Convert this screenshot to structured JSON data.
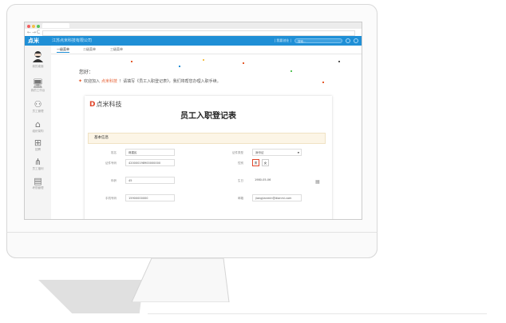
{
  "app": {
    "logo": "点米",
    "company": "江苏点米科技有限公司",
    "header_links": [
      "| 我要创业 |"
    ],
    "search_placeholder": "搜索..."
  },
  "sidebar": {
    "user_label": "我的桌面",
    "items": [
      {
        "icon": "desktop-icon",
        "glyph": "🖥",
        "label": "我的工作台"
      },
      {
        "icon": "staff-icon",
        "glyph": "⚇",
        "label": "员工管理"
      },
      {
        "icon": "org-icon",
        "glyph": "⌂",
        "label": "组织架构"
      },
      {
        "icon": "bag-icon",
        "glyph": "⊞",
        "label": "招聘"
      },
      {
        "icon": "clothes-icon",
        "glyph": "⋔",
        "label": "员工福利"
      },
      {
        "icon": "calendar-icon",
        "glyph": "▤",
        "label": "考勤管理"
      }
    ]
  },
  "tabs": [
    "一级菜单",
    "二级菜单",
    "三级菜单"
  ],
  "greeting": "您好：",
  "welcome": {
    "prefix": "欢迎加入",
    "company": "点米科技",
    "suffix": "！请填写《员工入职登记表》，我们将帮您办理入职手续。"
  },
  "form": {
    "logo_mark": "D",
    "logo_text": "点米科技",
    "title": "员工入职登记表",
    "section": "基本信息",
    "fields": [
      {
        "label": "姓名",
        "value": "蒋建民"
      },
      {
        "label": "证件类型",
        "value": "身份证"
      },
      {
        "label": "证件号码",
        "value": "420000198900000000"
      },
      {
        "label": "性别",
        "value": ""
      },
      {
        "label": "年龄",
        "value": "45"
      },
      {
        "label": "生日",
        "value": "1980-05-06"
      },
      {
        "label": "手机号码",
        "value": "15900000000"
      },
      {
        "label": "邮箱",
        "value": "jiangjianmin@dianmi.com"
      }
    ],
    "gender": [
      "男",
      "女"
    ]
  },
  "colors": {
    "header": "#1f8fd6",
    "accent": "#e55a2b",
    "section_bg": "#fcf5e6"
  }
}
